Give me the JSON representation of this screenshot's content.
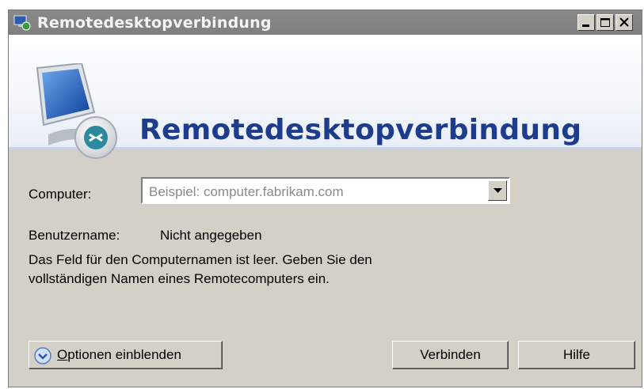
{
  "window": {
    "title": "Remotedesktopverbindung",
    "controls": {
      "minimize": "minimize",
      "maximize": "maximize",
      "close": "close"
    }
  },
  "banner": {
    "heading": "Remotedesktopverbindung",
    "icon": "remote-desktop-monitor-icon"
  },
  "form": {
    "computer_label": "Computer:",
    "computer_placeholder": "Beispiel: computer.fabrikam.com",
    "username_label": "Benutzername:",
    "username_value": "Nicht angegeben",
    "message_line1": "Das Feld für den Computernamen ist leer. Geben Sie den",
    "message_line2": "vollständigen Namen eines Remotecomputers ein."
  },
  "buttons": {
    "options_mnemonic": "O",
    "options_rest": "ptionen einblenden",
    "connect": "Verbinden",
    "help": "Hilfe"
  },
  "colors": {
    "titlebar": "#7f7f7f",
    "heading": "#1e3c8c",
    "dialog_bg": "#d4d0c8"
  }
}
